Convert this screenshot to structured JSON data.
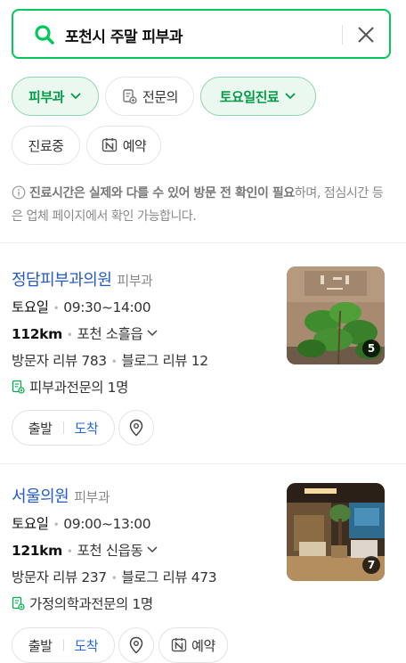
{
  "search": {
    "query": "포천시 주말 피부과",
    "icons": {
      "search": "search-icon",
      "clear": "close-icon"
    }
  },
  "filters": [
    {
      "label": "피부과",
      "active": true,
      "dropdown": true
    },
    {
      "label": "전문의",
      "active": false,
      "icon": "document-plus-icon"
    },
    {
      "label": "토요일진료",
      "active": true,
      "dropdown": true
    },
    {
      "label": "진료중",
      "active": false
    },
    {
      "label": "예약",
      "active": false,
      "icon": "naver-n-icon"
    }
  ],
  "notice": {
    "bold": "진료시간은 실제와 다를 수 있어 방문 전 확인이 필요",
    "rest": "하며, 점심시간 등은 업체 페이지에서 확인 가능합니다."
  },
  "results": [
    {
      "name": "정담피부과의원",
      "category": "피부과",
      "day": "토요일",
      "hours": "09:30~14:00",
      "distance": "112km",
      "location": "포천 소흘읍",
      "visitor_review": "방문자 리뷰 783",
      "blog_review": "블로그 리뷰 12",
      "specialists": "피부과전문의 1명",
      "photo_count": "5",
      "buttons": {
        "start": "출발",
        "arrive": "도착"
      }
    },
    {
      "name": "서울의원",
      "category": "피부과",
      "day": "토요일",
      "hours": "09:00~13:00",
      "distance": "121km",
      "location": "포천 신읍동",
      "visitor_review": "방문자 리뷰 237",
      "blog_review": "블로그 리뷰 473",
      "specialists": "가정의학과전문의 1명",
      "photo_count": "7",
      "buttons": {
        "start": "출발",
        "arrive": "도착",
        "reserve": "예약"
      }
    }
  ],
  "colors": {
    "accent": "#03c75a",
    "link": "#2459c6",
    "arrive": "#2468d8"
  }
}
